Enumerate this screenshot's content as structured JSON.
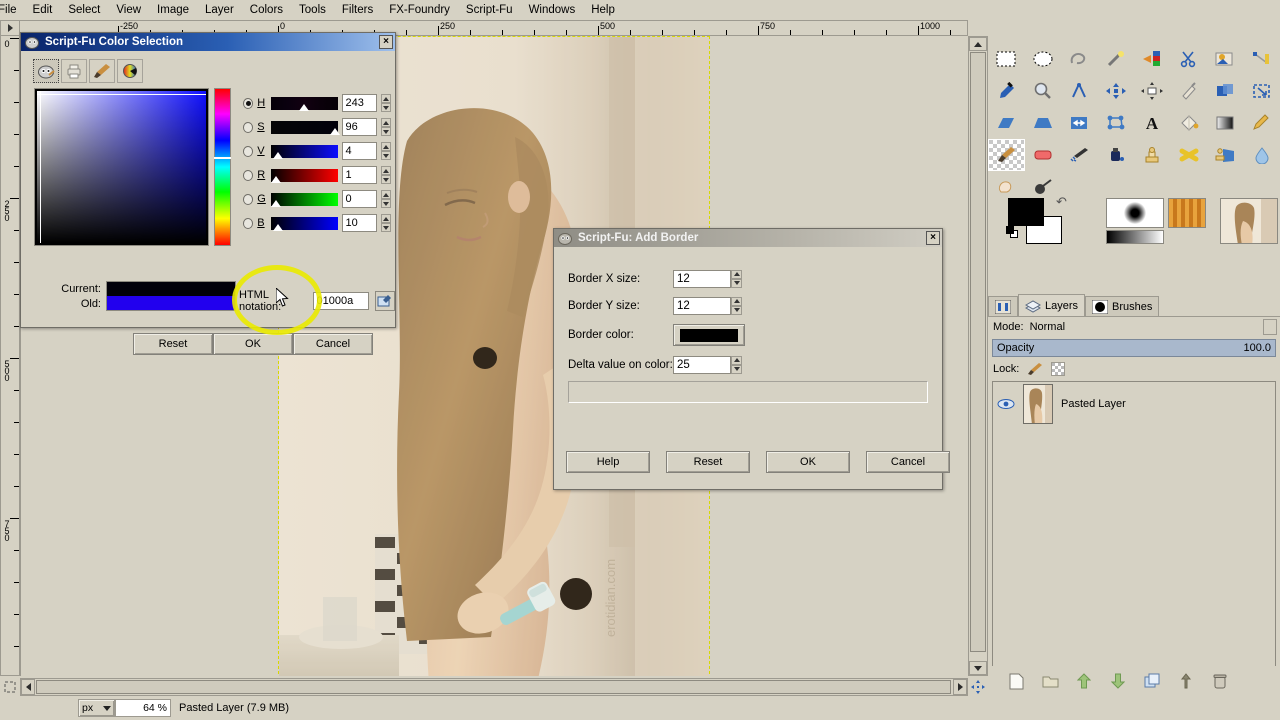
{
  "app": {
    "name": "GIMP"
  },
  "menubar": {
    "items": [
      {
        "label": "File"
      },
      {
        "label": "Edit"
      },
      {
        "label": "Select"
      },
      {
        "label": "View"
      },
      {
        "label": "Image"
      },
      {
        "label": "Layer"
      },
      {
        "label": "Colors"
      },
      {
        "label": "Tools"
      },
      {
        "label": "Filters"
      },
      {
        "label": "FX-Foundry"
      },
      {
        "label": "Script-Fu"
      },
      {
        "label": "Windows"
      },
      {
        "label": "Help"
      }
    ]
  },
  "rulers": {
    "horizontal_labels": [
      "-250",
      "0",
      "250",
      "500",
      "750",
      "1000"
    ],
    "vertical_labels": [
      "0",
      "250",
      "500",
      "750"
    ],
    "unit": "px"
  },
  "statusbar": {
    "unit_value": "px",
    "zoom_value": "64 %",
    "status_text": "Pasted Layer (7.9 MB)"
  },
  "color_dialog": {
    "title": "Script-Fu Color Selection",
    "close_label": "×",
    "tabs": [
      {
        "name": "gimp-tab"
      },
      {
        "name": "printer-tab"
      },
      {
        "name": "watercolor-tab"
      },
      {
        "name": "colorwheel-tab"
      }
    ],
    "channels": [
      {
        "key": "H",
        "label": "H",
        "value": "243",
        "selected": true
      },
      {
        "key": "S",
        "label": "S",
        "value": "96",
        "selected": false
      },
      {
        "key": "V",
        "label": "V",
        "value": "4",
        "selected": false
      },
      {
        "key": "R",
        "label": "R",
        "value": "1",
        "selected": false
      },
      {
        "key": "G",
        "label": "G",
        "value": "0",
        "selected": false
      },
      {
        "key": "B",
        "label": "B",
        "value": "10",
        "selected": false
      }
    ],
    "current_label": "Current:",
    "old_label": "Old:",
    "current_color": "#01000a",
    "old_color": "#2200ee",
    "html_label": "HTML notation:",
    "html_value": "01000a",
    "buttons": [
      {
        "label": "Reset"
      },
      {
        "label": "OK"
      },
      {
        "label": "Cancel"
      }
    ]
  },
  "border_dialog": {
    "title": "Script-Fu: Add Border",
    "close_label": "×",
    "fields": [
      {
        "label": "Border X size:",
        "value": "12",
        "type": "spin"
      },
      {
        "label": "Border Y size:",
        "value": "12",
        "type": "spin"
      },
      {
        "label": "Border color:",
        "value": "#000000",
        "type": "color"
      },
      {
        "label": "Delta value on color:",
        "value": "25",
        "type": "spin"
      }
    ],
    "buttons": [
      {
        "label": "Help"
      },
      {
        "label": "Reset"
      },
      {
        "label": "OK"
      },
      {
        "label": "Cancel"
      }
    ]
  },
  "dock": {
    "tools_row1": [
      "rect-select-icon",
      "ellipse-select-icon",
      "free-select-icon",
      "fuzzy-select-icon",
      "select-by-color-icon",
      "scissors-select-icon",
      "foreground-select-icon",
      "paths-icon"
    ],
    "tools_row2": [
      "color-picker-icon",
      "zoom-icon",
      "measure-icon",
      "move-icon",
      "alignment-icon",
      "crop-icon",
      "rotate-icon",
      "scale-icon"
    ],
    "tools_row3": [
      "shear-icon",
      "perspective-icon",
      "flip-icon",
      "cage-transform-icon",
      "text-icon",
      "bucket-fill-icon",
      "gradient-icon",
      "pencil-icon"
    ],
    "tools_row4": [
      "paintbrush-icon",
      "eraser-icon",
      "airbrush-icon",
      "ink-icon",
      "clone-icon",
      "heal-icon",
      "perspective-clone-icon",
      "blur-sharpen-icon"
    ],
    "tools_row5": [
      "smudge-icon",
      "dodge-burn-icon"
    ],
    "selected_tool": "paintbrush-icon",
    "foreground_color": "#000000",
    "background_color": "#ffffff",
    "tabs": [
      {
        "label": "",
        "icon": "tool-options-icon",
        "active": false
      },
      {
        "label": "Layers",
        "icon": "layers-icon",
        "active": true
      },
      {
        "label": "Brushes",
        "icon": "brushes-icon",
        "active": false
      }
    ],
    "layers": {
      "mode_label": "Mode:",
      "mode_value": "Normal",
      "opacity_label": "Opacity",
      "opacity_value": "100.0",
      "lock_label": "Lock:",
      "rows": [
        {
          "name": "Pasted Layer",
          "visible": true
        }
      ]
    },
    "bottom_buttons": [
      "new-layer-icon",
      "new-layer-group-icon",
      "raise-layer-icon",
      "lower-layer-icon",
      "duplicate-layer-icon",
      "anchor-layer-icon",
      "delete-layer-icon"
    ]
  },
  "colors": {
    "accent_blue": "#0a246a",
    "dialog_bg": "#d6d2c4",
    "highlight_yellow": "#eaea00",
    "opacity_bar": "#a9b8cc"
  }
}
